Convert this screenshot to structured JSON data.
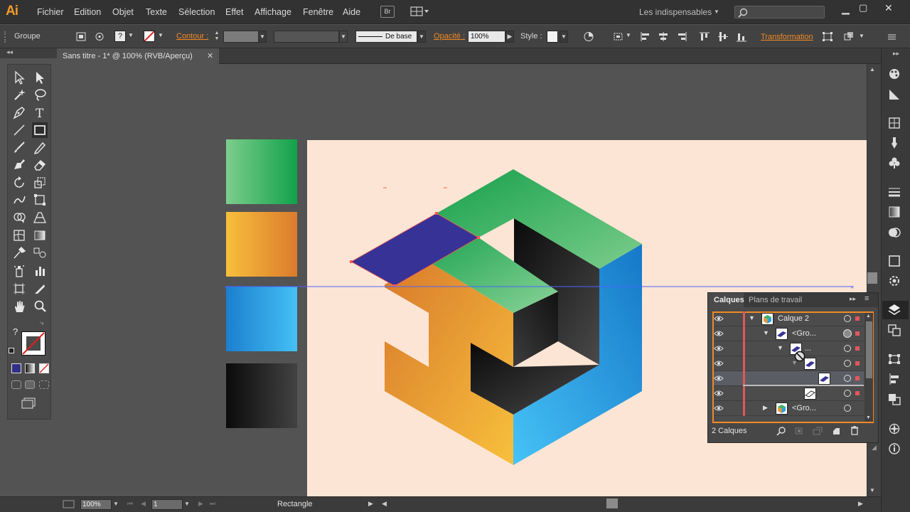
{
  "app": {
    "logo": "Ai"
  },
  "menu": {
    "items": [
      "Fichier",
      "Edition",
      "Objet",
      "Texte",
      "Sélection",
      "Effet",
      "Affichage",
      "Fenêtre",
      "Aide"
    ],
    "bridge": "Br",
    "workspace": "Les indispensables"
  },
  "control": {
    "selection_label": "Groupe",
    "contour_label": "Contour :",
    "stroke_profile": "De base",
    "opacity_label": "Opacité :",
    "opacity_value": "100%",
    "style_label": "Style :",
    "transform_label": "Transformation",
    "accent_color": "#f08a24"
  },
  "document": {
    "tab_title": "Sans titre - 1* @ 100% (RVB/Aperçu)",
    "close_glyph": "✕"
  },
  "tools": {
    "help_glyph": "?"
  },
  "swatches": [
    "#2fb05a",
    "#f0a43a",
    "#2aa6ea",
    "#1d1d1d"
  ],
  "artwork": {
    "background": "#fde5d5",
    "colors": {
      "green": "#3cb36a",
      "orange": "#ea9a33",
      "blue": "#2f9ee0",
      "dark": "#1e1e1e",
      "selected_face": "#3a3596"
    }
  },
  "status": {
    "zoom": "100%",
    "page": "1",
    "tool_status": "Rectangle"
  },
  "layers_panel": {
    "tab_layers": "Calques",
    "tab_artboards": "Plans de travail",
    "rows": [
      {
        "name": "Calque 2",
        "level": 0,
        "expanded": true
      },
      {
        "name": "<Gro...",
        "level": 1,
        "expanded": true
      },
      {
        "name": "...",
        "level": 2,
        "expanded": true
      },
      {
        "name": "",
        "level": 3,
        "expanded": true
      },
      {
        "name": "",
        "level": 4,
        "selected": true
      },
      {
        "name": "",
        "level": 4
      },
      {
        "name": "<Gro...",
        "level": 1,
        "expanded": false
      }
    ],
    "count": "2 Calques"
  }
}
